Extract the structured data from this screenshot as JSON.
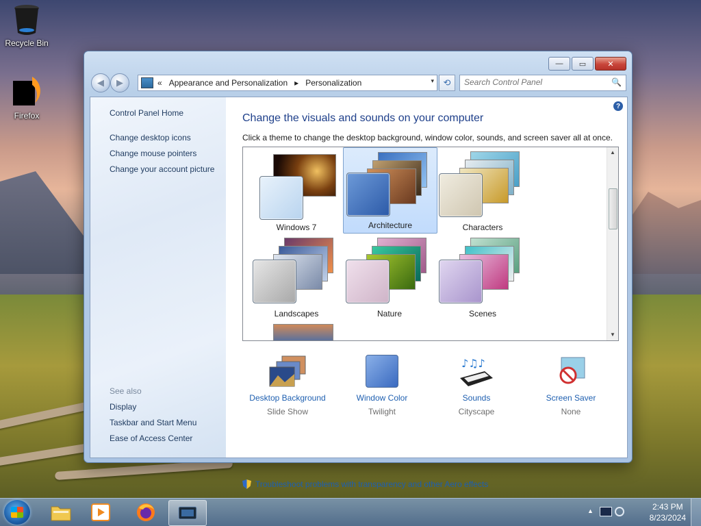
{
  "desktop": {
    "icons": [
      {
        "label": "Recycle Bin"
      },
      {
        "label": "Firefox"
      }
    ]
  },
  "window": {
    "controls": {
      "minimize": "—",
      "maximize": "▭",
      "close": "✕"
    },
    "nav": {
      "back": "◀",
      "forward": "▶"
    },
    "address": {
      "prefix": "«",
      "crumbs": [
        "Appearance and Personalization",
        "Personalization"
      ],
      "separator": "▸",
      "dropdown": "▾"
    },
    "refresh": "⟲",
    "search": {
      "placeholder": "Search Control Panel",
      "icon": "🔍"
    }
  },
  "sidebar": {
    "home": "Control Panel Home",
    "links": [
      "Change desktop icons",
      "Change mouse pointers",
      "Change your account picture"
    ],
    "see_also_label": "See also",
    "see_also": [
      "Display",
      "Taskbar and Start Menu",
      "Ease of Access Center"
    ]
  },
  "main": {
    "title": "Change the visuals and sounds on your computer",
    "subtitle": "Click a theme to change the desktop background, window color, sounds, and screen saver all at once.",
    "help": "?",
    "themes": [
      {
        "name": "Windows 7",
        "selected": false
      },
      {
        "name": "Architecture",
        "selected": true
      },
      {
        "name": "Characters",
        "selected": false
      },
      {
        "name": "Landscapes",
        "selected": false
      },
      {
        "name": "Nature",
        "selected": false
      },
      {
        "name": "Scenes",
        "selected": false
      }
    ],
    "scroll": {
      "up": "▲",
      "down": "▼"
    },
    "settings": [
      {
        "name": "Desktop Background",
        "value": "Slide Show"
      },
      {
        "name": "Window Color",
        "value": "Twilight"
      },
      {
        "name": "Sounds",
        "value": "Cityscape"
      },
      {
        "name": "Screen Saver",
        "value": "None"
      }
    ],
    "troubleshoot": "Troubleshoot problems with transparency and other Aero effects"
  },
  "taskbar": {
    "tray_arrow": "▲",
    "clock": {
      "time": "2:43 PM",
      "date": "8/23/2024"
    }
  },
  "colors": {
    "link_blue": "#1e5fb0",
    "title_blue": "#1e3f8a",
    "selection": "#c1dbfc"
  }
}
